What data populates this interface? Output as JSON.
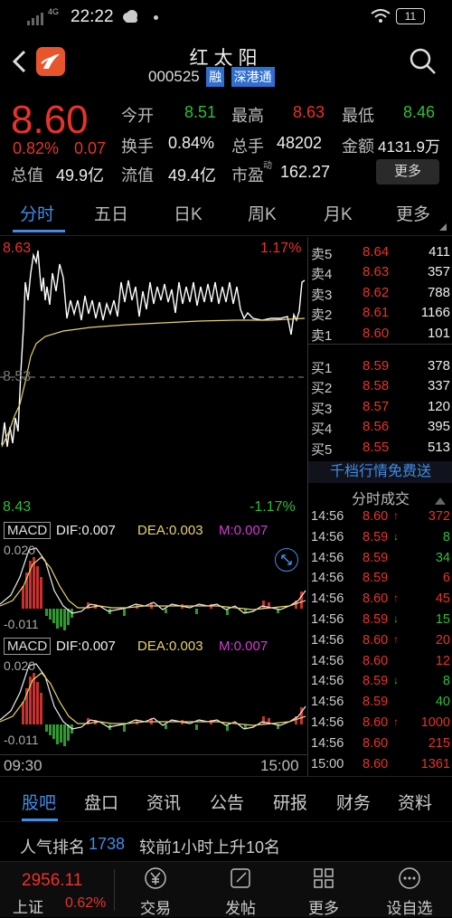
{
  "status": {
    "signal": "4G",
    "time": "22:22",
    "battery": "11"
  },
  "header": {
    "name": "红太阳",
    "code": "000525",
    "tag_margin": "融",
    "tag_connect": "深港通"
  },
  "quote": {
    "price": "8.60",
    "change_pct": "0.82%",
    "change": "0.07",
    "stats": [
      {
        "label": "今开",
        "value": "8.51",
        "color": "green"
      },
      {
        "label": "最高",
        "value": "8.63",
        "color": "red"
      },
      {
        "label": "最低",
        "value": "8.46",
        "color": "green"
      },
      {
        "label": "换手",
        "value": "0.84%",
        "color": "white"
      },
      {
        "label": "总手",
        "value": "48202",
        "color": "white"
      },
      {
        "label": "金额",
        "value": "4131.9万",
        "color": "white"
      },
      {
        "label": "总值",
        "value": "49.9亿",
        "color": "white"
      },
      {
        "label": "流值",
        "value": "49.4亿",
        "color": "white"
      },
      {
        "label": "市盈",
        "value": "162.27",
        "color": "white"
      }
    ],
    "pe_sup": "动",
    "more_btn": "更多"
  },
  "tabs": [
    "分时",
    "五日",
    "日K",
    "周K",
    "月K",
    "更多"
  ],
  "chart": {
    "high_price": "8.63",
    "high_pct": "1.17%",
    "mid_price": "8.53",
    "low_price": "8.43",
    "low_pct": "-1.17%",
    "macd1": {
      "label": "MACD",
      "dif": "DIF:0.007",
      "dea": "DEA:0.003",
      "m": "M:0.007",
      "top": "0.020",
      "bottom": "-0.011"
    },
    "macd2": {
      "label": "MACD",
      "dif": "DIF:0.007",
      "dea": "DEA:0.003",
      "m": "M:0.007",
      "top": "0.020",
      "bottom": "-0.011"
    },
    "time_start": "09:30",
    "time_end": "15:00"
  },
  "book": {
    "asks": [
      {
        "label": "卖5",
        "price": "8.64",
        "vol": "411"
      },
      {
        "label": "卖4",
        "price": "8.63",
        "vol": "357"
      },
      {
        "label": "卖3",
        "price": "8.62",
        "vol": "788"
      },
      {
        "label": "卖2",
        "price": "8.61",
        "vol": "1166"
      },
      {
        "label": "卖1",
        "price": "8.60",
        "vol": "101"
      }
    ],
    "bids": [
      {
        "label": "买1",
        "price": "8.59",
        "vol": "378"
      },
      {
        "label": "买2",
        "price": "8.58",
        "vol": "337"
      },
      {
        "label": "买3",
        "price": "8.57",
        "vol": "120"
      },
      {
        "label": "买4",
        "price": "8.56",
        "vol": "395"
      },
      {
        "label": "买5",
        "price": "8.55",
        "vol": "513"
      }
    ],
    "promo": "千档行情免费送",
    "ticks_title": "分时成交",
    "ticks": [
      {
        "time": "14:56",
        "price": "8.60",
        "dir": "↑",
        "vol": "372",
        "pc": "red",
        "vc": "red"
      },
      {
        "time": "14:56",
        "price": "8.59",
        "dir": "↓",
        "vol": "8",
        "pc": "red",
        "vc": "green"
      },
      {
        "time": "14:56",
        "price": "8.59",
        "dir": "",
        "vol": "34",
        "pc": "red",
        "vc": "green"
      },
      {
        "time": "14:56",
        "price": "8.59",
        "dir": "",
        "vol": "6",
        "pc": "red",
        "vc": "red"
      },
      {
        "time": "14:56",
        "price": "8.60",
        "dir": "↑",
        "vol": "45",
        "pc": "red",
        "vc": "red"
      },
      {
        "time": "14:56",
        "price": "8.59",
        "dir": "↓",
        "vol": "15",
        "pc": "red",
        "vc": "green"
      },
      {
        "time": "14:56",
        "price": "8.60",
        "dir": "↑",
        "vol": "20",
        "pc": "red",
        "vc": "red"
      },
      {
        "time": "14:56",
        "price": "8.60",
        "dir": "",
        "vol": "12",
        "pc": "red",
        "vc": "red"
      },
      {
        "time": "14:56",
        "price": "8.59",
        "dir": "↓",
        "vol": "8",
        "pc": "red",
        "vc": "green"
      },
      {
        "time": "14:56",
        "price": "8.59",
        "dir": "",
        "vol": "40",
        "pc": "red",
        "vc": "green"
      },
      {
        "time": "14:56",
        "price": "8.60",
        "dir": "↑",
        "vol": "1000",
        "pc": "red",
        "vc": "red"
      },
      {
        "time": "14:56",
        "price": "8.60",
        "dir": "",
        "vol": "215",
        "pc": "red",
        "vc": "red"
      },
      {
        "time": "15:00",
        "price": "8.60",
        "dir": "",
        "vol": "1361",
        "pc": "red",
        "vc": "red"
      }
    ]
  },
  "bottom_tabs": [
    "股吧",
    "盘口",
    "资讯",
    "公告",
    "研报",
    "财务",
    "资料"
  ],
  "rank": {
    "label": "人气排名",
    "value": "1738",
    "note": "较前1小时上升10名"
  },
  "footer": {
    "index_value": "2956.11",
    "index_name": "上证",
    "index_pct": "0.62%",
    "items": [
      {
        "label": "交易",
        "icon": "yen-icon"
      },
      {
        "label": "发帖",
        "icon": "edit-icon"
      },
      {
        "label": "更多",
        "icon": "grid-icon"
      },
      {
        "label": "设自选",
        "icon": "dots-icon"
      }
    ]
  },
  "colors": {
    "up": "#e8322c",
    "down": "#2fbf35",
    "accent": "#3f8de8",
    "avg_line": "#e8d36a",
    "dif": "#eeeeee",
    "dea": "#e8d36a",
    "m": "#d83ad8"
  }
}
